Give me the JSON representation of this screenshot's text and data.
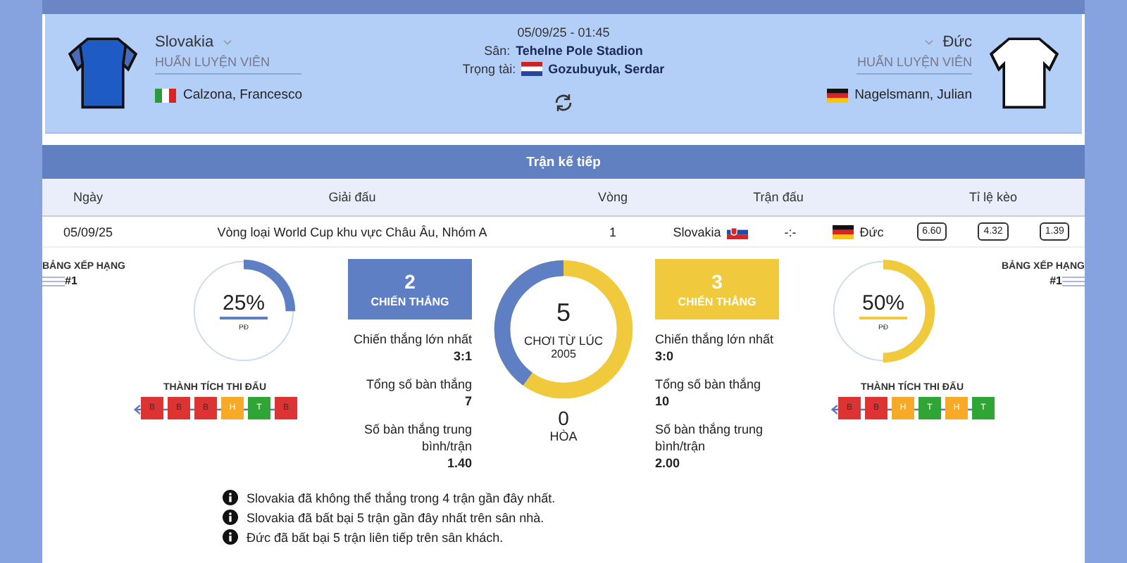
{
  "match": {
    "date_time": "05/09/25 - 01:45",
    "venue_label": "Sân:",
    "venue": "Tehelne Pole Stadion",
    "referee_label": "Trọng tài:",
    "referee": "Gozubuyuk, Serdar",
    "home": {
      "name": "Slovakia",
      "coach_label": "HUẤN LUYỆN VIÊN",
      "coach": "Calzona, Francesco"
    },
    "away": {
      "name": "Đức",
      "coach_label": "HUẤN LUYỆN VIÊN",
      "coach": "Nagelsmann, Julian"
    }
  },
  "next_match": {
    "title": "Trận kế tiếp",
    "columns": [
      "Ngày",
      "Giải đấu",
      "Vòng",
      "Trận đấu",
      "Tỉ lệ kèo"
    ],
    "row": {
      "date": "05/09/25",
      "competition": "Vòng loại World Cup khu vực Châu Âu, Nhóm A",
      "round": "1",
      "home": "Slovakia",
      "score": "-:-",
      "away": "Đức",
      "odds": [
        "6.60",
        "4.32",
        "1.39"
      ]
    }
  },
  "stats": {
    "home": {
      "color": "#5f7fc4",
      "rank_label": "BẢNG XẾP HẠNG",
      "rank": "#1",
      "percent": "25%",
      "level": 0.25,
      "percent_label": "PĐ",
      "form_label": "THÀNH TÍCH THI ĐẤU",
      "form": [
        {
          "kind": "loss",
          "label": "B"
        },
        {
          "kind": "loss",
          "label": "B"
        },
        {
          "kind": "loss",
          "label": "B"
        },
        {
          "kind": "draw",
          "label": "H"
        },
        {
          "kind": "win",
          "label": "T"
        },
        {
          "kind": "loss",
          "label": "B"
        }
      ],
      "wins": "2",
      "wins_label": "CHIẾN THẮNG",
      "figures": [
        {
          "label": "Chiến thắng lớn nhất",
          "value": "3:1"
        },
        {
          "label": "Tổng số bàn thắng",
          "value": "7"
        },
        {
          "label": "Số bàn thắng trung bình/trận",
          "value": "1.40"
        }
      ]
    },
    "away": {
      "color": "#f0c93c",
      "rank_label": "BẢNG XẾP HẠNG",
      "rank": "#1",
      "percent": "50%",
      "level": 0.5,
      "percent_label": "PĐ",
      "form_label": "THÀNH TÍCH THI ĐẤU",
      "form": [
        {
          "kind": "loss",
          "label": "B"
        },
        {
          "kind": "loss",
          "label": "B"
        },
        {
          "kind": "draw",
          "label": "H"
        },
        {
          "kind": "win",
          "label": "T"
        },
        {
          "kind": "draw",
          "label": "H"
        },
        {
          "kind": "win",
          "label": "T"
        }
      ],
      "wins": "3",
      "wins_label": "CHIẾN THẮNG",
      "figures": [
        {
          "label": "Chiến thắng lớn nhất",
          "value": "3:0"
        },
        {
          "label": "Tổng số bàn thắng",
          "value": "10"
        },
        {
          "label": "Số bàn thắng trung bình/trận",
          "value": "2.00"
        }
      ]
    },
    "total": {
      "played": "5",
      "since_label": "CHƠI TỪ LÚC",
      "since": "2005",
      "level": 0.4,
      "draws": "0",
      "draws_label": "HÒA"
    }
  },
  "notes": [
    "Slovakia đã không thể thắng trong 4 trận gần đây nhất.",
    "Slovakia đã bất bại 5 trận gần đây nhất trên sân nhà.",
    "Đức đã bất bại 5 trận liên tiếp trên sân khách."
  ]
}
